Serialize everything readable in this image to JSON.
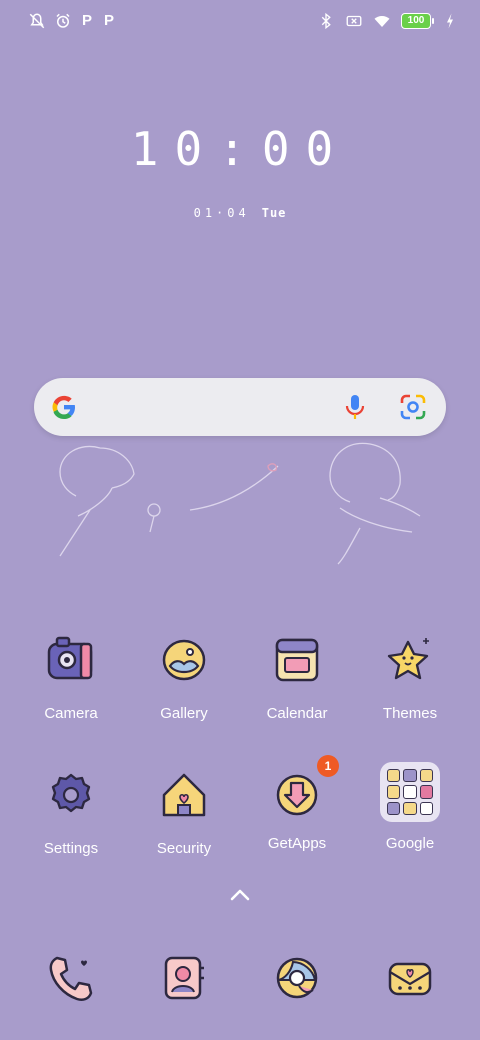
{
  "status_bar": {
    "left_icons": [
      "notifications-off-icon",
      "alarm-icon",
      "p-app-icon",
      "p-app-icon"
    ],
    "p_letter": "P",
    "right_icons": [
      "bluetooth-icon",
      "no-sim-icon",
      "wifi-icon",
      "battery-icon",
      "charging-icon"
    ],
    "battery_level": "100"
  },
  "clock": {
    "time": "10:00",
    "date": "01·04",
    "day": "Tue"
  },
  "search": {
    "icons": [
      "google-logo-icon",
      "microphone-icon",
      "google-lens-icon"
    ]
  },
  "apps": [
    {
      "label": "Camera",
      "icon": "camera-icon"
    },
    {
      "label": "Gallery",
      "icon": "gallery-icon"
    },
    {
      "label": "Calendar",
      "icon": "calendar-icon"
    },
    {
      "label": "Themes",
      "icon": "themes-star-icon"
    },
    {
      "label": "Settings",
      "icon": "settings-gear-icon"
    },
    {
      "label": "Security",
      "icon": "security-house-icon"
    },
    {
      "label": "GetApps",
      "icon": "getapps-download-icon",
      "badge": "1"
    },
    {
      "label": "Google",
      "icon": "google-folder-icon"
    }
  ],
  "dock": [
    {
      "icon": "phone-icon"
    },
    {
      "icon": "contacts-icon"
    },
    {
      "icon": "browser-icon"
    },
    {
      "icon": "messages-icon"
    }
  ],
  "colors": {
    "background": "#a89ccb",
    "badge": "#ef5a24",
    "battery": "#6ad04a"
  }
}
